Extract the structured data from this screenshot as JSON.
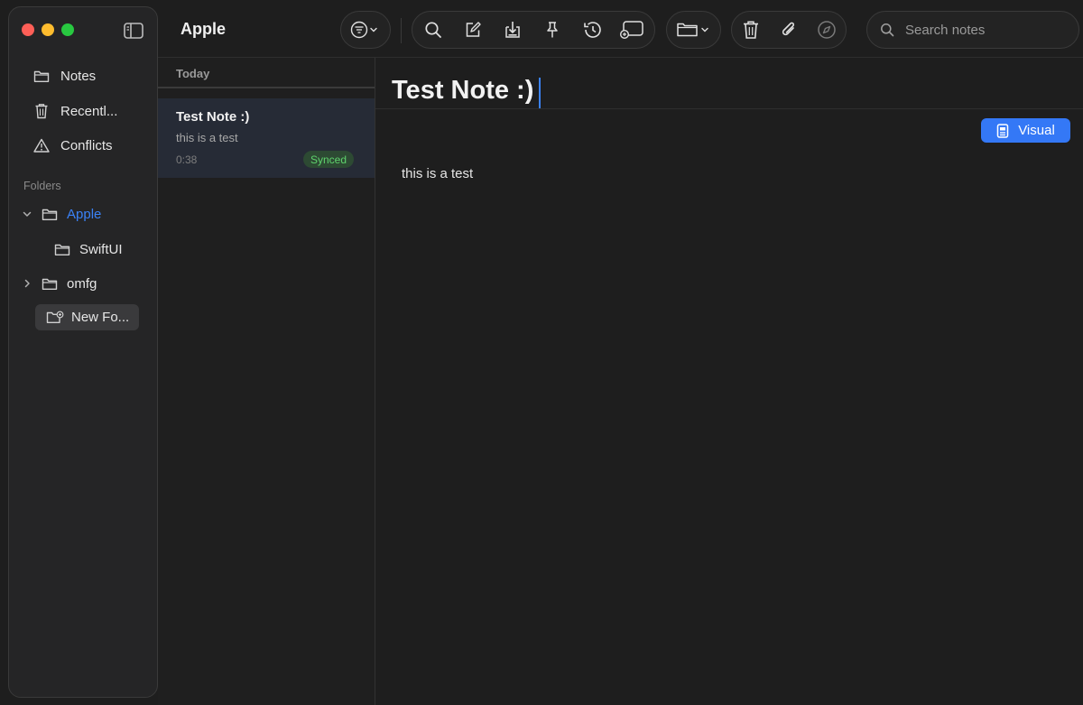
{
  "window": {
    "title": "Apple"
  },
  "sidebar": {
    "toggle_icon": "sidebar-toggle-icon",
    "smart_items": [
      {
        "label": "Notes",
        "icon": "folder-icon"
      },
      {
        "label": "Recentl...",
        "icon": "trash-icon"
      },
      {
        "label": "Conflicts",
        "icon": "warning-icon"
      }
    ],
    "folders_header": "Folders",
    "folders": [
      {
        "label": "Apple",
        "expanded": true,
        "selected": true
      },
      {
        "label": "SwiftUI",
        "child_of": "Apple"
      },
      {
        "label": "omfg",
        "expanded": false
      }
    ],
    "new_folder_label": "New Fo..."
  },
  "toolbar": {
    "filter_icon": "filter-icon",
    "buttons": [
      "search-icon",
      "compose-icon",
      "download-icon",
      "pin-icon",
      "history-icon",
      "snippet-icon",
      "folder-icon",
      "trash-icon",
      "paperclip-icon",
      "compass-icon"
    ],
    "search_placeholder": "Search notes"
  },
  "note_list": {
    "section": "Today",
    "notes": [
      {
        "title": "Test Note :)",
        "snippet": "this is a test",
        "time": "0:38",
        "status": "Synced"
      }
    ]
  },
  "editor": {
    "title": "Test Note :)",
    "mode_button": "Visual",
    "body": "this is a test"
  },
  "colors": {
    "accent": "#3478f6",
    "selected_folder": "#3b82f6",
    "synced_bg": "#2d4a33",
    "synced_text": "#5fd36d",
    "selected_note_bg": "#262b36"
  }
}
